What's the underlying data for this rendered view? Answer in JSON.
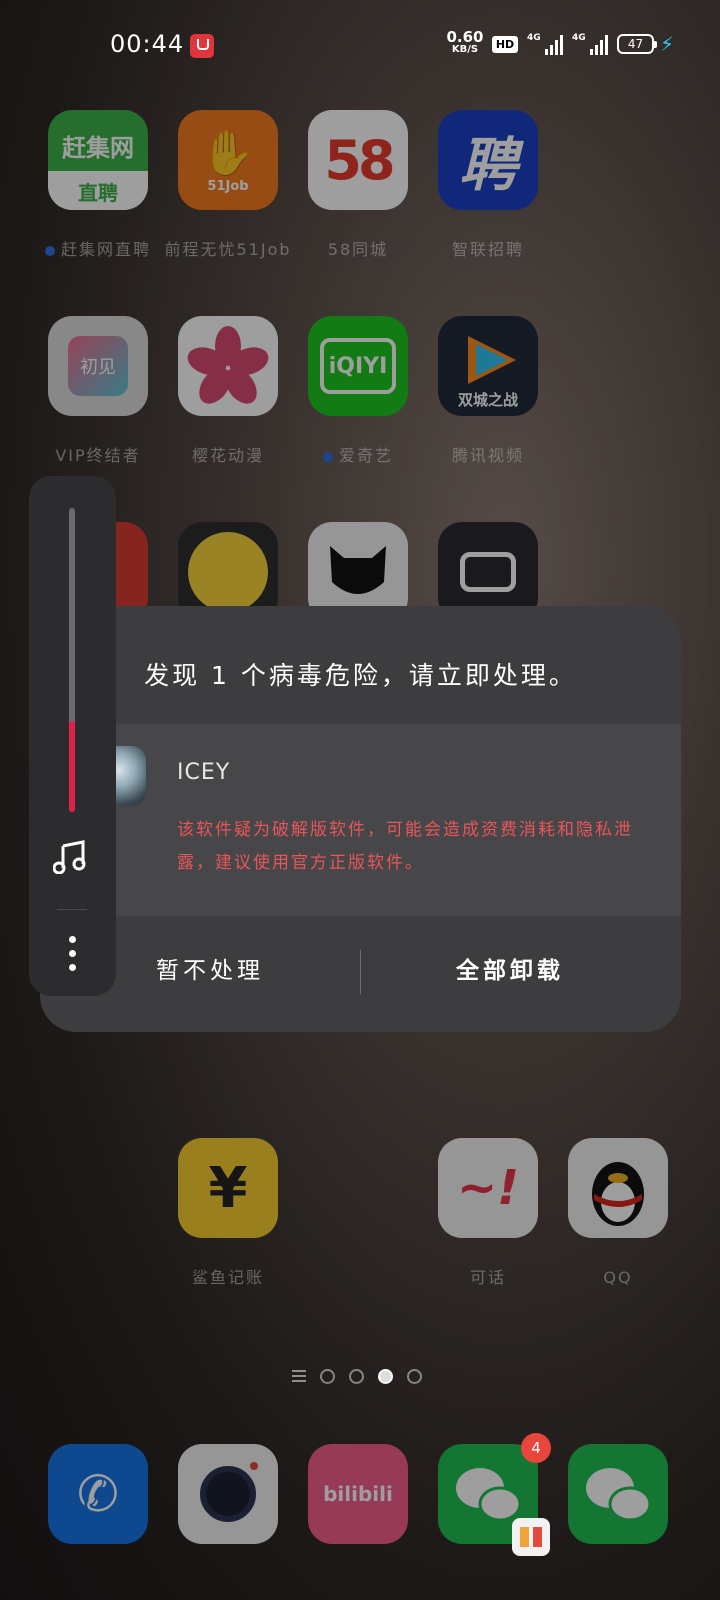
{
  "status_bar": {
    "time": "00:44",
    "net_speed_value": "0.60",
    "net_speed_unit": "KB/S",
    "hd_label": "HD",
    "signal1_label": "4G",
    "signal2_label": "4G",
    "battery_level": "47",
    "charging": true
  },
  "home_screen": {
    "row1": [
      {
        "name": "赶集网直聘",
        "icon": "ganji-icon",
        "icon_text_top": "赶集网",
        "icon_text_bottom": "直聘",
        "color": "#3cb14a",
        "new_dot": true
      },
      {
        "name": "前程无忧51Job",
        "icon": "51job-icon",
        "icon_text": "51Job",
        "color": "#f47a20",
        "new_dot": false
      },
      {
        "name": "58同城",
        "icon": "58-icon",
        "icon_text": "58",
        "color": "#ffffff",
        "new_dot": false
      },
      {
        "name": "智联招聘",
        "icon": "zhaopin-icon",
        "icon_text": "聘",
        "color": "#1a3fc4",
        "new_dot": false
      }
    ],
    "row2": [
      {
        "name": "VIP终结者",
        "icon": "vip-icon",
        "icon_text": "初见",
        "color": "#dcdcdc",
        "new_dot": false
      },
      {
        "name": "樱花动漫",
        "icon": "sakura-icon",
        "color": "#ffffff",
        "new_dot": false
      },
      {
        "name": "爱奇艺",
        "icon": "iqiyi-icon",
        "icon_text": "iQIYI",
        "color": "#1ec71e",
        "new_dot": true
      },
      {
        "name": "腾讯视频",
        "icon": "tencent-video-icon",
        "icon_text": "双城之战",
        "color": "#1f2a3a",
        "new_dot": false
      }
    ],
    "row3": [
      {
        "icon": "netease-music-icon",
        "color": "#d83a30"
      },
      {
        "icon": "qq-music-icon",
        "color": "#f7d43a"
      },
      {
        "icon": "cat-icon",
        "color": "#f2f2f2"
      },
      {
        "icon": "bilibili-tv-icon",
        "color": "#2a2a30"
      }
    ],
    "row5": [
      {
        "name": "鲨鱼记账",
        "icon": "shark-ledger-icon",
        "icon_text": "¥",
        "color": "#f6cd2e"
      },
      {
        "name": "可话",
        "icon": "kehua-icon",
        "icon_text": "~!",
        "color": "#f2f2f2"
      },
      {
        "name": "QQ",
        "icon": "qq-icon",
        "color": "#f2f2f2"
      }
    ]
  },
  "volume": {
    "level": 0.3
  },
  "dialog": {
    "title": "发现 1 个病毒危险，请立即处理。",
    "threat_name": "ICEY",
    "threat_desc": "该软件疑为破解版软件，可能会造成资费消耗和隐私泄露，建议使用官方正版软件。",
    "ignore_label": "暂不处理",
    "uninstall_label": "全部卸载"
  },
  "page_indicator": {
    "pages": 4,
    "active": 2
  },
  "dock": [
    {
      "icon": "phone-icon",
      "color": "#1676e8"
    },
    {
      "icon": "camera-icon",
      "color": "#f2f2f2"
    },
    {
      "icon": "bilibili-icon",
      "icon_text": "bilibili",
      "color": "#f25d8e"
    },
    {
      "icon": "wechat-clone-icon",
      "color": "#1fbf53"
    },
    {
      "icon": "wechat-icon",
      "color": "#1fbf53"
    }
  ],
  "wechat_badge": "4"
}
